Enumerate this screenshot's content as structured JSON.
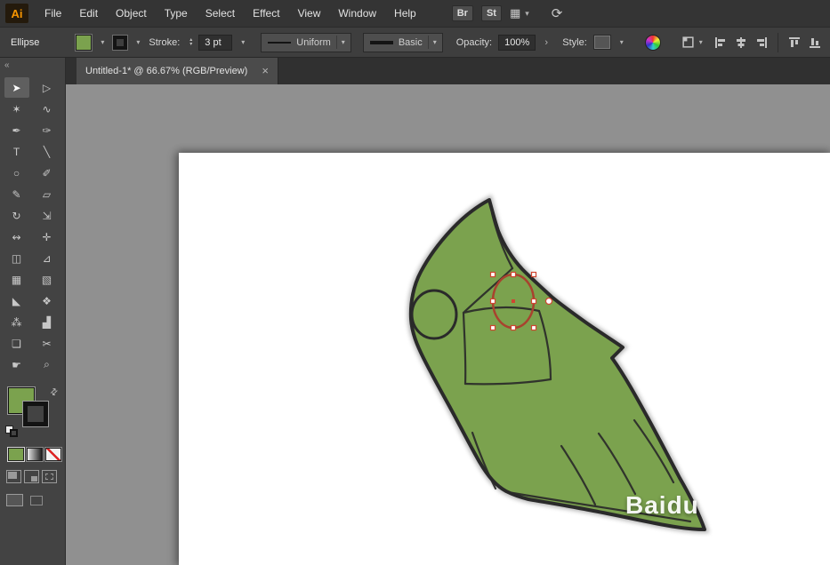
{
  "colors": {
    "artwork_green": "#7ba24e",
    "outline": "#2a2a2a",
    "selection_red": "#cf4631",
    "ellipse_stroke": "#a8422e",
    "accent_orange": "#f79500"
  },
  "glyphs": {
    "chevron_down": "▾",
    "chevron_right": "›",
    "collapse": "«",
    "swap": "⇄",
    "close": "×",
    "stepper_up": "▴",
    "stepper_down": "▾",
    "arrange_documents": "▦",
    "sync": "⟳"
  },
  "menu_bar": {
    "logo": "Ai",
    "items": [
      "File",
      "Edit",
      "Object",
      "Type",
      "Select",
      "Effect",
      "View",
      "Window",
      "Help"
    ],
    "bridge_label": "Br",
    "stock_label": "St"
  },
  "control_bar": {
    "tool_label": "Ellipse",
    "stroke_label": "Stroke:",
    "stroke_value": "3 pt",
    "width_profile": "Uniform",
    "brush": "Basic",
    "opacity_label": "Opacity:",
    "opacity_value": "100%",
    "style_label": "Style:"
  },
  "document_tab": {
    "title": "Untitled-1* @ 66.67% (RGB/Preview)"
  },
  "tools_panel": {
    "tools": [
      {
        "name": "selection",
        "glyph": "➤",
        "active": true
      },
      {
        "name": "direct-selection",
        "glyph": "▷"
      },
      {
        "name": "magic-wand",
        "glyph": "✶"
      },
      {
        "name": "lasso",
        "glyph": "∿"
      },
      {
        "name": "pen",
        "glyph": "✒"
      },
      {
        "name": "curvature",
        "glyph": "✑"
      },
      {
        "name": "type",
        "glyph": "T"
      },
      {
        "name": "line-segment",
        "glyph": "╲"
      },
      {
        "name": "ellipse",
        "glyph": "○"
      },
      {
        "name": "paintbrush",
        "glyph": "✐"
      },
      {
        "name": "pencil",
        "glyph": "✎"
      },
      {
        "name": "eraser",
        "glyph": "▱"
      },
      {
        "name": "rotate",
        "glyph": "↻"
      },
      {
        "name": "scale",
        "glyph": "⇲"
      },
      {
        "name": "width",
        "glyph": "↭"
      },
      {
        "name": "free-transform",
        "glyph": "✛"
      },
      {
        "name": "shape-builder",
        "glyph": "◫"
      },
      {
        "name": "perspective-grid",
        "glyph": "⊿"
      },
      {
        "name": "mesh",
        "glyph": "▦"
      },
      {
        "name": "gradient",
        "glyph": "▧"
      },
      {
        "name": "eyedropper",
        "glyph": "◣"
      },
      {
        "name": "blend",
        "glyph": "❖"
      },
      {
        "name": "symbol-sprayer",
        "glyph": "⁂"
      },
      {
        "name": "column-graph",
        "glyph": "▟"
      },
      {
        "name": "artboard",
        "glyph": "❏"
      },
      {
        "name": "slice",
        "glyph": "✂"
      },
      {
        "name": "hand",
        "glyph": "☛"
      },
      {
        "name": "zoom",
        "glyph": "⌕"
      }
    ]
  },
  "canvas": {
    "watermark": "Baidu"
  }
}
